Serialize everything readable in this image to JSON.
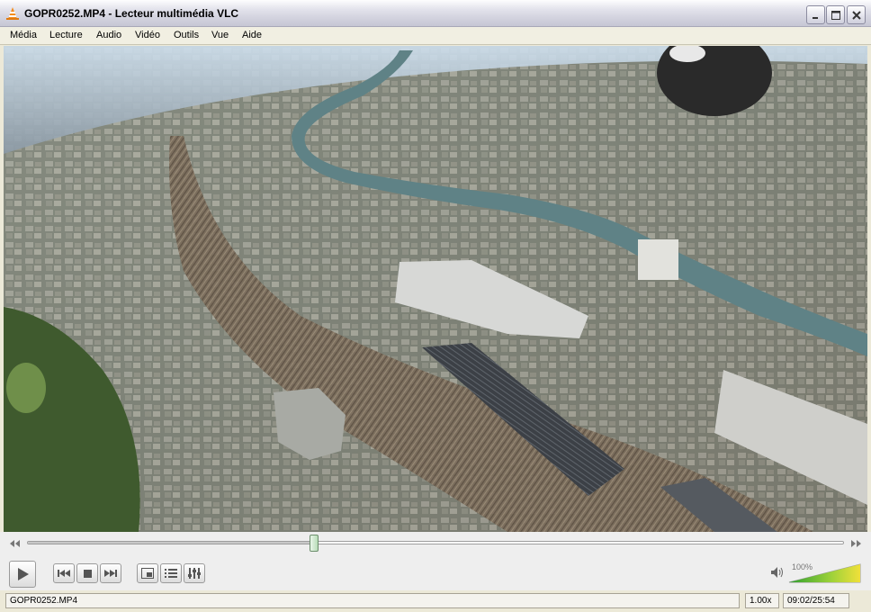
{
  "window": {
    "title": "GOPR0252.MP4 - Lecteur multimédia VLC"
  },
  "menu": {
    "items": [
      "Média",
      "Lecture",
      "Audio",
      "Vidéo",
      "Outils",
      "Vue",
      "Aide"
    ]
  },
  "player": {
    "progress_fraction": 0.3509,
    "volume_label": "100%",
    "volume_fraction": 1.0
  },
  "status": {
    "filename": "GOPR0252.MP4",
    "speed": "1.00x",
    "time": "09:02/25:54"
  },
  "icons": {
    "app": "vlc-cone-icon",
    "play": "play-icon",
    "previous": "previous-icon",
    "stop": "stop-icon",
    "next": "next-icon",
    "fullscreen": "fullscreen-icon",
    "playlist": "playlist-icon",
    "extended": "extended-settings-icon",
    "volume": "speaker-icon"
  },
  "colors": {
    "titlebar": "#d6d6e0",
    "cone_orange": "#f28c1e",
    "seek_handle": "#b8dcb8",
    "volume_green": "#3fb13f"
  }
}
